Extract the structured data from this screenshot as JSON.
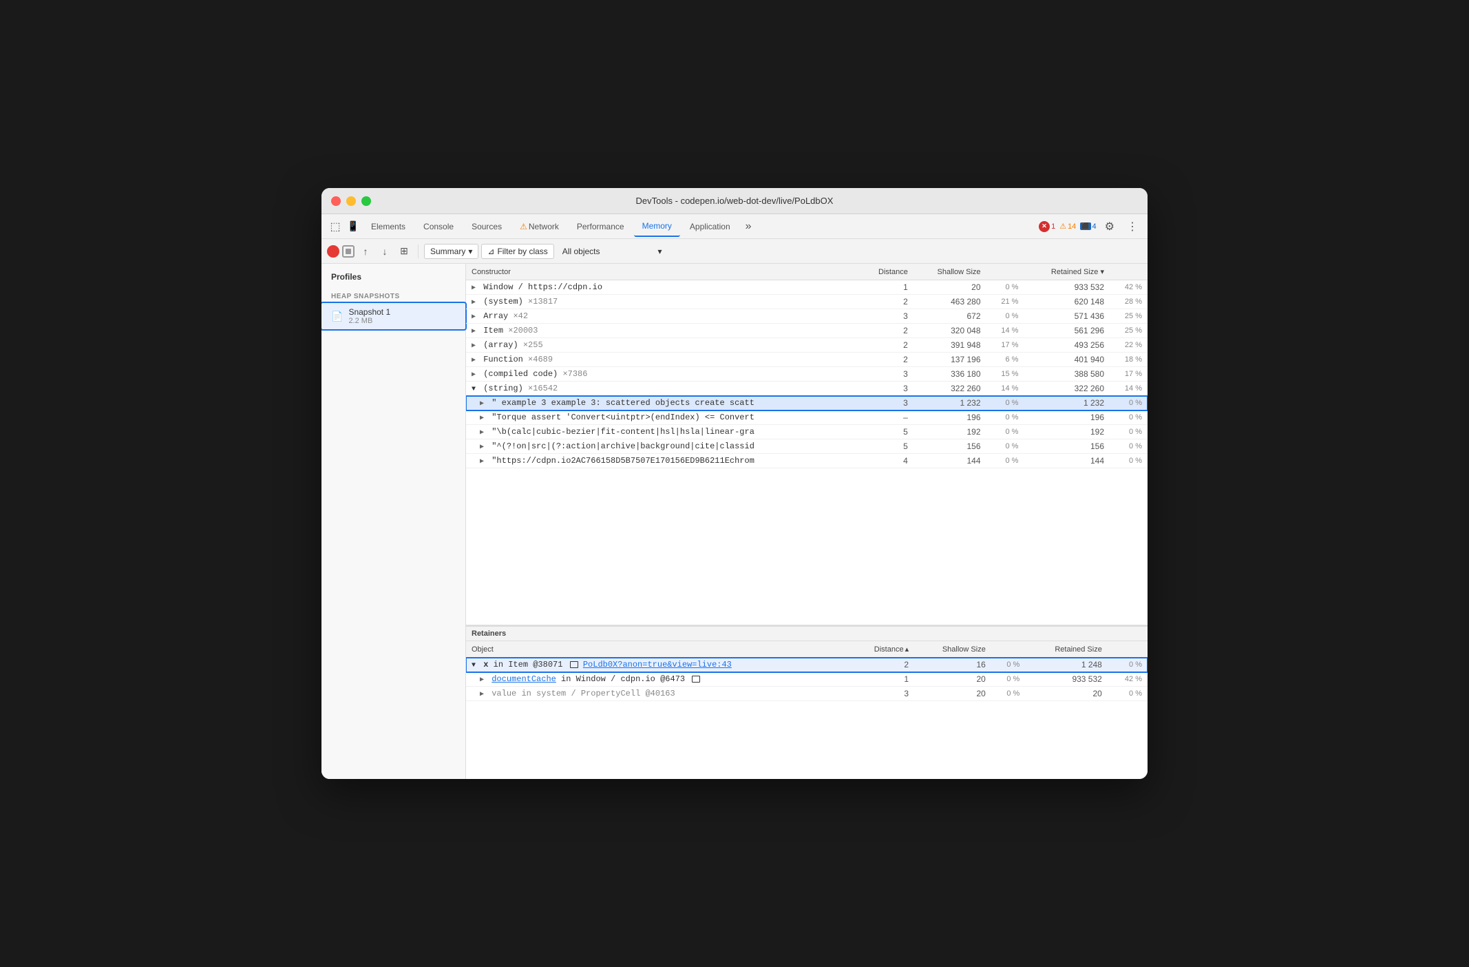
{
  "window": {
    "title": "DevTools - codepen.io/web-dot-dev/live/PoLdbOX"
  },
  "tabs": [
    {
      "label": "Elements",
      "active": false
    },
    {
      "label": "Console",
      "active": false
    },
    {
      "label": "Sources",
      "active": false
    },
    {
      "label": "Network",
      "active": false,
      "warning": true
    },
    {
      "label": "Performance",
      "active": false
    },
    {
      "label": "Memory",
      "active": true
    },
    {
      "label": "Application",
      "active": false
    }
  ],
  "badges": {
    "errors": "1",
    "warnings": "14",
    "info": "4"
  },
  "toolbar": {
    "summary_label": "Summary",
    "filter_label": "Filter by class",
    "all_objects_label": "All objects"
  },
  "sidebar": {
    "title": "Profiles",
    "section_label": "HEAP SNAPSHOTS",
    "snapshot_name": "Snapshot 1",
    "snapshot_size": "2.2 MB"
  },
  "table": {
    "headers": [
      "Constructor",
      "Distance",
      "Shallow Size",
      "",
      "Retained Size",
      ""
    ],
    "rows": [
      {
        "constructor": "Window / https://cdpn.io",
        "indent": 0,
        "expanded": false,
        "distance": "1",
        "shallow": "20",
        "shallow_pct": "0 %",
        "retained": "933 532",
        "retained_pct": "42 %"
      },
      {
        "constructor": "(system)",
        "count": "×13817",
        "indent": 0,
        "expanded": false,
        "distance": "2",
        "shallow": "463 280",
        "shallow_pct": "21 %",
        "retained": "620 148",
        "retained_pct": "28 %"
      },
      {
        "constructor": "Array",
        "count": "×42",
        "indent": 0,
        "expanded": false,
        "distance": "3",
        "shallow": "672",
        "shallow_pct": "0 %",
        "retained": "571 436",
        "retained_pct": "25 %"
      },
      {
        "constructor": "Item",
        "count": "×20003",
        "indent": 0,
        "expanded": false,
        "distance": "2",
        "shallow": "320 048",
        "shallow_pct": "14 %",
        "retained": "561 296",
        "retained_pct": "25 %"
      },
      {
        "constructor": "(array)",
        "count": "×255",
        "indent": 0,
        "expanded": false,
        "distance": "2",
        "shallow": "391 948",
        "shallow_pct": "17 %",
        "retained": "493 256",
        "retained_pct": "22 %"
      },
      {
        "constructor": "Function",
        "count": "×4689",
        "indent": 0,
        "expanded": false,
        "distance": "2",
        "shallow": "137 196",
        "shallow_pct": "6 %",
        "retained": "401 940",
        "retained_pct": "18 %"
      },
      {
        "constructor": "(compiled code)",
        "count": "×7386",
        "indent": 0,
        "expanded": false,
        "distance": "3",
        "shallow": "336 180",
        "shallow_pct": "15 %",
        "retained": "388 580",
        "retained_pct": "17 %"
      },
      {
        "constructor": "(string)",
        "count": "×16542",
        "indent": 0,
        "expanded": true,
        "distance": "3",
        "shallow": "322 260",
        "shallow_pct": "14 %",
        "retained": "322 260",
        "retained_pct": "14 %"
      },
      {
        "constructor": "\" example 3 example 3: scattered objects create scatt",
        "indent": 1,
        "expanded": false,
        "highlighted": true,
        "distance": "3",
        "shallow": "1 232",
        "shallow_pct": "0 %",
        "retained": "1 232",
        "retained_pct": "0 %"
      },
      {
        "constructor": "\"Torque assert 'Convert<uintptr>(endIndex) <= Convert",
        "indent": 1,
        "expanded": false,
        "red": true,
        "distance": "–",
        "shallow": "196",
        "shallow_pct": "0 %",
        "retained": "196",
        "retained_pct": "0 %"
      },
      {
        "constructor": "\"\\b(calc|cubic-bezier|fit-content|hsl|hsla|linear-gra",
        "indent": 1,
        "expanded": false,
        "red": true,
        "distance": "5",
        "shallow": "192",
        "shallow_pct": "0 %",
        "retained": "192",
        "retained_pct": "0 %"
      },
      {
        "constructor": "\"^(?!on|src|(?:action|archive|background|cite|classid",
        "indent": 1,
        "expanded": false,
        "red": true,
        "distance": "5",
        "shallow": "156",
        "shallow_pct": "0 %",
        "retained": "156",
        "retained_pct": "0 %"
      },
      {
        "constructor": "\"https://cdpn.io2AC766158D5B7507E170156ED9B6211Echrom",
        "indent": 1,
        "expanded": false,
        "red": true,
        "distance": "4",
        "shallow": "144",
        "shallow_pct": "0 %",
        "retained": "144",
        "retained_pct": "0 %"
      }
    ]
  },
  "retainers": {
    "header": "Retainers",
    "table_headers": [
      "Object",
      "Distance",
      "Shallow Size",
      "",
      "Retained Size",
      ""
    ],
    "rows": [
      {
        "object": "x in Item @38071",
        "link": "PoLdb0X?anon=true&view=live:43",
        "has_window_icon": true,
        "indent": 0,
        "selected": true,
        "highlighted_outline": true,
        "distance": "2",
        "shallow": "16",
        "shallow_pct": "0 %",
        "retained": "1 248",
        "retained_pct": "0 %"
      },
      {
        "object": "documentCache in Window / cdpn.io @6473",
        "has_window_icon": true,
        "indent": 1,
        "expanded": false,
        "distance": "1",
        "shallow": "20",
        "shallow_pct": "0 %",
        "retained": "933 532",
        "retained_pct": "42 %"
      },
      {
        "object": "value in system / PropertyCell @40163",
        "indent": 1,
        "expanded": false,
        "distance": "3",
        "shallow": "20",
        "shallow_pct": "0 %",
        "retained": "20",
        "retained_pct": "0 %"
      }
    ]
  }
}
